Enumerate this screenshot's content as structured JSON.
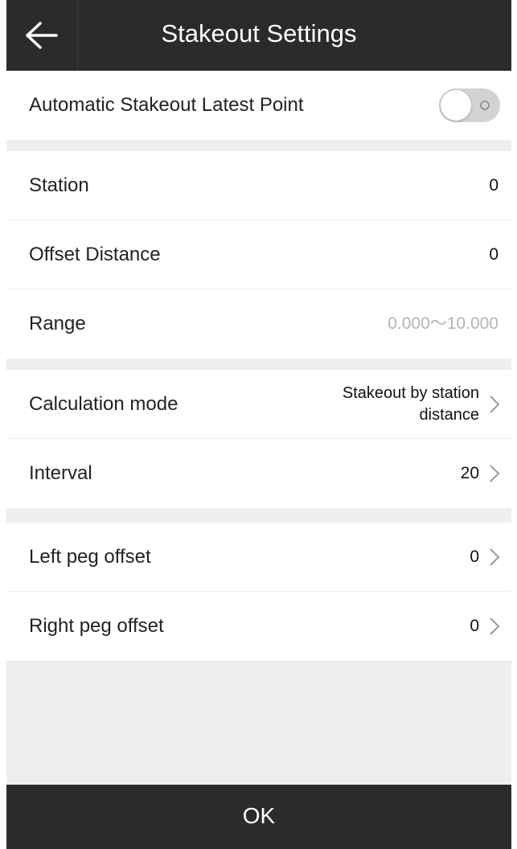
{
  "header": {
    "title": "Stakeout Settings",
    "back_icon": "arrow-left-icon"
  },
  "auto_stakeout": {
    "label": "Automatic Stakeout Latest Point",
    "enabled": false
  },
  "station": {
    "label": "Station",
    "value": "0"
  },
  "offset_distance": {
    "label": "Offset Distance",
    "value": "0"
  },
  "range": {
    "label": "Range",
    "placeholder": "0.000～10.000"
  },
  "calculation_mode": {
    "label": "Calculation mode",
    "value_line1": "Stakeout by station",
    "value_line2": "distance"
  },
  "interval": {
    "label": "Interval",
    "value": "20"
  },
  "left_peg_offset": {
    "label": "Left peg offset",
    "value": "0"
  },
  "right_peg_offset": {
    "label": "Right peg offset",
    "value": "0"
  },
  "footer": {
    "ok_label": "OK"
  },
  "colors": {
    "bar": "#2b2b2b",
    "background": "#eeeeee",
    "placeholder": "#b5b5b5"
  }
}
